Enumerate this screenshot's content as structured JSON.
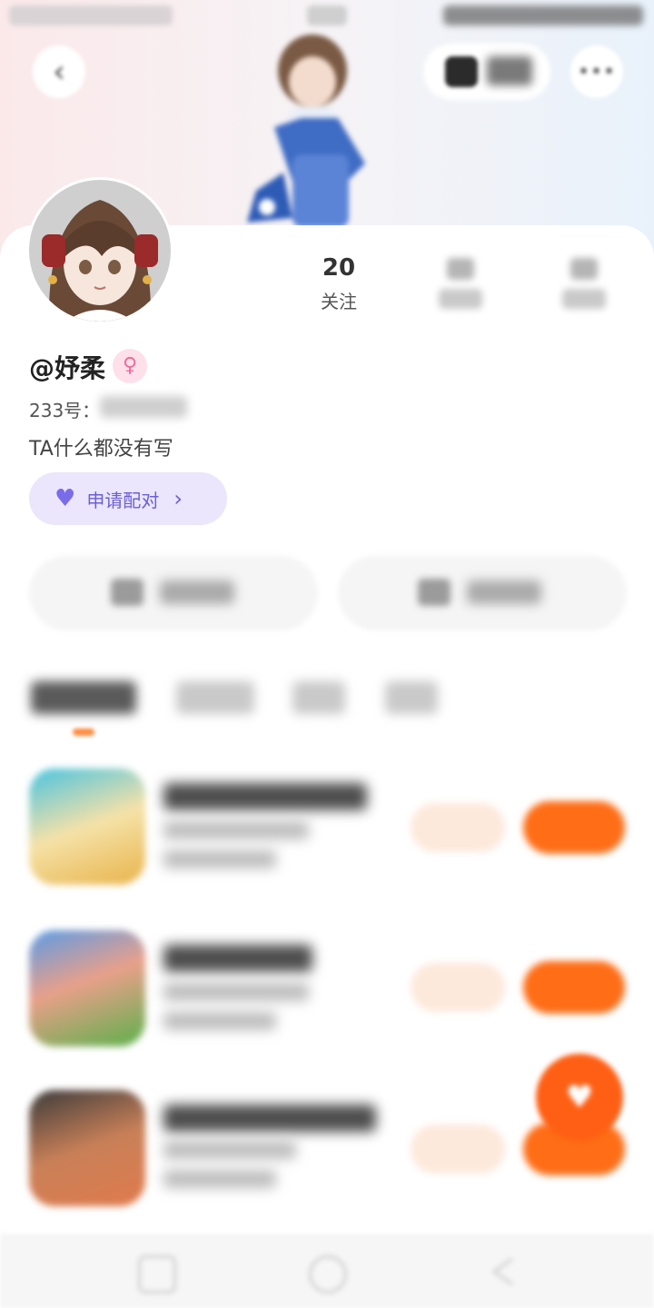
{
  "status_bar": {
    "time": "",
    "left_info": "",
    "right_info": ""
  },
  "header": {
    "back_icon": "‹",
    "dress_label": "",
    "more_icon": "•••"
  },
  "profile": {
    "username": "@妤柔",
    "gender_icon": "♀",
    "id_label": "233号：",
    "id_value": "",
    "bio": "TA什么都没有写"
  },
  "stats": [
    {
      "value": "20",
      "label": "关注"
    },
    {
      "value": "",
      "label": ""
    },
    {
      "value": "",
      "label": ""
    }
  ],
  "match": {
    "icon": "♥",
    "label": "申请配对",
    "chevron": "›"
  },
  "actions": [
    {
      "label": ""
    },
    {
      "label": ""
    }
  ],
  "tabs": [
    {
      "label": ""
    },
    {
      "label": ""
    },
    {
      "label": ""
    },
    {
      "label": ""
    }
  ],
  "games": [
    {
      "title": "",
      "meta": "",
      "players": ""
    },
    {
      "title": "",
      "meta": "",
      "players": ""
    },
    {
      "title": "",
      "meta": "",
      "players": ""
    }
  ],
  "fab": {
    "icon": "♥"
  },
  "colors": {
    "accent": "#ff6d16",
    "match_bg": "#ebe6fb",
    "match_text": "#6a5fd7",
    "gender_pink": "#f06a9a"
  }
}
